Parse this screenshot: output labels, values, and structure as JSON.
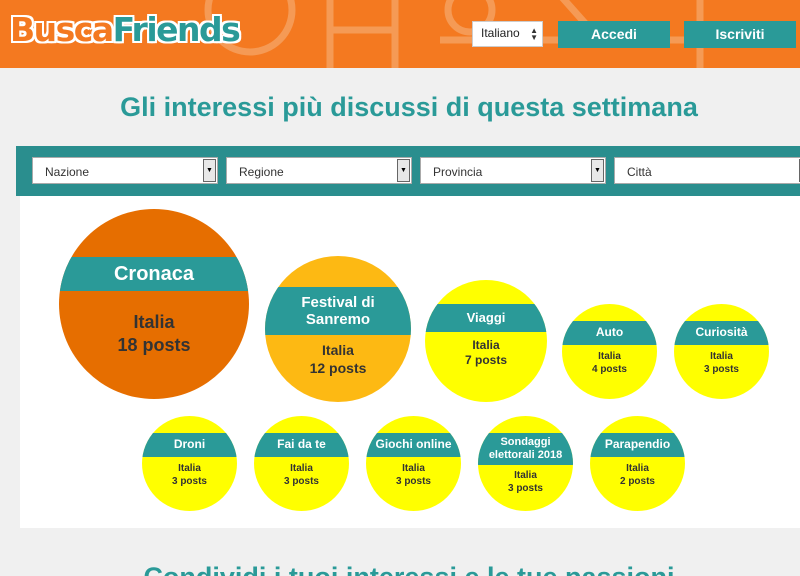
{
  "header": {
    "logo_part1": "Busca",
    "logo_part2": "Friends",
    "language": "Italiano",
    "login_label": "Accedi",
    "signup_label": "Iscriviti"
  },
  "main": {
    "title": "Gli interessi più discussi di questa settimana",
    "filters": [
      "Nazione",
      "Regione",
      "Provincia",
      "Città"
    ],
    "topics": [
      {
        "name": "Cronaca",
        "country": "Italia",
        "posts": "18 posts"
      },
      {
        "name": "Festival di Sanremo",
        "country": "Italia",
        "posts": "12 posts"
      },
      {
        "name": "Viaggi",
        "country": "Italia",
        "posts": "7 posts"
      },
      {
        "name": "Auto",
        "country": "Italia",
        "posts": "4 posts"
      },
      {
        "name": "Curiosità",
        "country": "Italia",
        "posts": "3 posts"
      },
      {
        "name": "Droni",
        "country": "Italia",
        "posts": "3 posts"
      },
      {
        "name": "Fai da te",
        "country": "Italia",
        "posts": "3 posts"
      },
      {
        "name": "Giochi online",
        "country": "Italia",
        "posts": "3 posts"
      },
      {
        "name": "Sondaggi elettorali 2018",
        "country": "Italia",
        "posts": "3 posts"
      },
      {
        "name": "Parapendio",
        "country": "Italia",
        "posts": "2 posts"
      }
    ],
    "bottom_title": "Condividi i tuoi interessi e le tue passioni"
  },
  "colors": {
    "header_orange": "#f47920",
    "teal": "#2a9a98",
    "bubble_large": "#e66e00",
    "bubble_medium": "#fdb913",
    "bubble_small": "#ffff00"
  }
}
